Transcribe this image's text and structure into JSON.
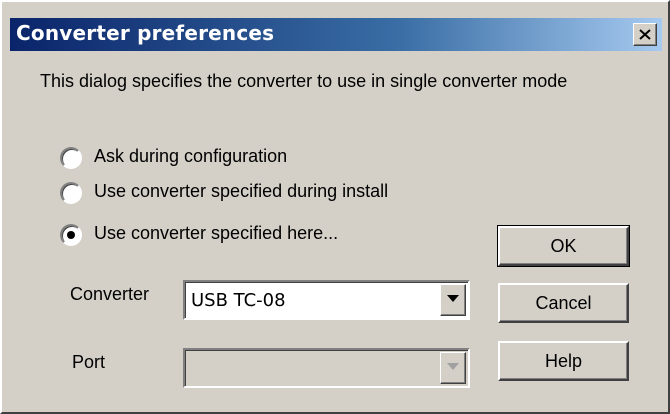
{
  "window": {
    "title": "Converter preferences"
  },
  "description": "This dialog specifies the converter to use in single converter mode",
  "radios": [
    {
      "label": "Ask during configuration",
      "checked": false
    },
    {
      "label": "Use converter specified during install",
      "checked": false
    },
    {
      "label": "Use converter specified here...",
      "checked": true
    }
  ],
  "buttons": {
    "ok": "OK",
    "cancel": "Cancel",
    "help": "Help"
  },
  "converter": {
    "label": "Converter",
    "value": "USB TC-08"
  },
  "port": {
    "label": "Port",
    "value": "",
    "enabled": false
  },
  "icons": {
    "close": "close-icon",
    "dropdown": "chevron-down-icon"
  },
  "colors": {
    "face": "#d4d0c8",
    "title_start": "#0a246a",
    "title_end": "#a6caf0"
  }
}
